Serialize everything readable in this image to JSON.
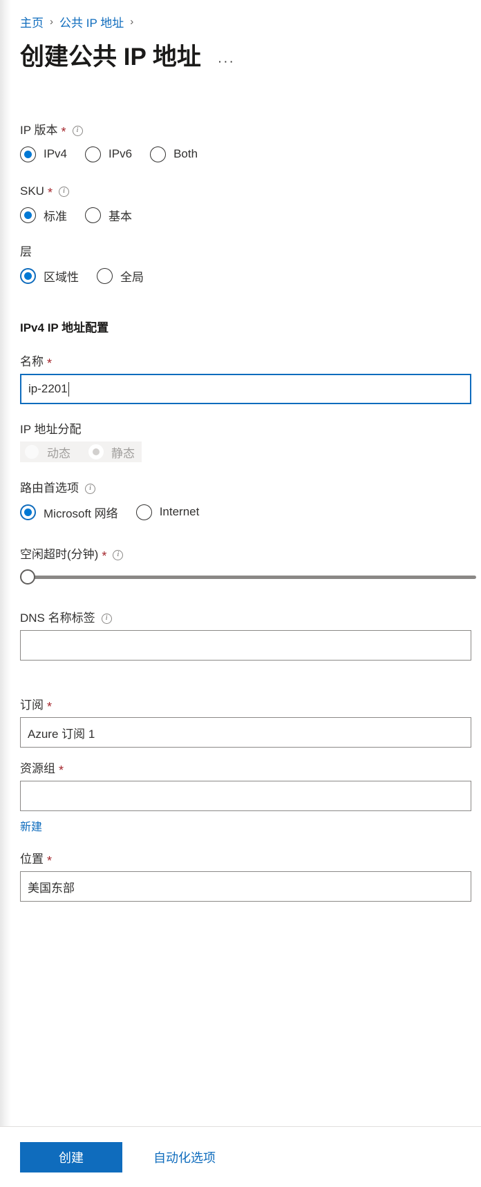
{
  "breadcrumb": {
    "items": [
      {
        "label": "主页"
      },
      {
        "label": "公共 IP 地址"
      }
    ],
    "separator": "›"
  },
  "header": {
    "title": "创建公共 IP 地址",
    "more_menu": "···"
  },
  "form": {
    "ip_version": {
      "label": "IP 版本",
      "required": "*",
      "info": "ⓘ",
      "options": [
        {
          "label": "IPv4",
          "selected": true
        },
        {
          "label": "IPv6",
          "selected": false
        },
        {
          "label": "Both",
          "selected": false
        }
      ]
    },
    "sku": {
      "label": "SKU",
      "required": "*",
      "info": "ⓘ",
      "options": [
        {
          "label": "标准",
          "selected": true
        },
        {
          "label": "基本",
          "selected": false
        }
      ]
    },
    "tier": {
      "label": "层",
      "options": [
        {
          "label": "区域性",
          "selected": true
        },
        {
          "label": "全局",
          "selected": false
        }
      ]
    },
    "section_ipv4": {
      "title": "IPv4 IP 地址配置"
    },
    "name": {
      "label": "名称",
      "required": "*",
      "value": "ip-2201"
    },
    "ip_assignment": {
      "label": "IP 地址分配",
      "options": [
        {
          "label": "动态",
          "selected": false
        },
        {
          "label": "静态",
          "selected": true
        }
      ]
    },
    "routing_preference": {
      "label": "路由首选项",
      "info": "ⓘ",
      "options": [
        {
          "label": "Microsoft 网络",
          "selected": true
        },
        {
          "label": "Internet",
          "selected": false
        }
      ]
    },
    "idle_timeout": {
      "label": "空闲超时(分钟)",
      "required": "*",
      "info": "ⓘ",
      "value": ""
    },
    "dns_name_label": {
      "label": "DNS 名称标签",
      "info": "ⓘ",
      "value": ""
    },
    "subscription": {
      "label": "订阅",
      "required": "*",
      "value": "Azure 订阅 1"
    },
    "resource_group": {
      "label": "资源组",
      "required": "*",
      "value": "",
      "create_new_link": "新建"
    },
    "location": {
      "label": "位置",
      "required": "*",
      "value": "美国东部"
    }
  },
  "footer": {
    "create_label": "创建",
    "automation_label": "自动化选项"
  },
  "colors": {
    "accent": "#0f6cbd",
    "radio_fill": "#0078d4",
    "required": "#a4262c",
    "text": "#323130"
  }
}
